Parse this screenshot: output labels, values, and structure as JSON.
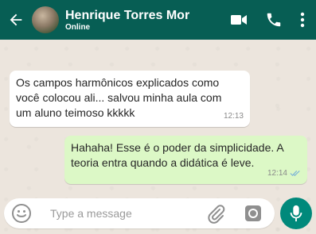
{
  "header": {
    "contact_name": "Henrique Torres Mor",
    "status": "Online",
    "icons": [
      "back-arrow-icon",
      "avatar",
      "video-call-icon",
      "phone-icon",
      "more-vertical-icon"
    ],
    "bg_color": "#075E54"
  },
  "messages": [
    {
      "direction": "incoming",
      "text": "Os campos harmônicos explicados como\nvocê colocou ali... salvou minha aula com\num aluno teimoso kkkkk",
      "time": "12:13"
    },
    {
      "direction": "outgoing",
      "text": "Hahaha! Esse é o poder da simplicidade. A\nteoria entra quando a didática é leve.",
      "time": "12:14",
      "read_receipt": "double-check-icon"
    }
  ],
  "composer": {
    "placeholder": "Type a message",
    "icons": [
      "emoji-icon",
      "attach-icon",
      "camera-icon",
      "mic-icon"
    ],
    "mic_color": "#00897B"
  }
}
